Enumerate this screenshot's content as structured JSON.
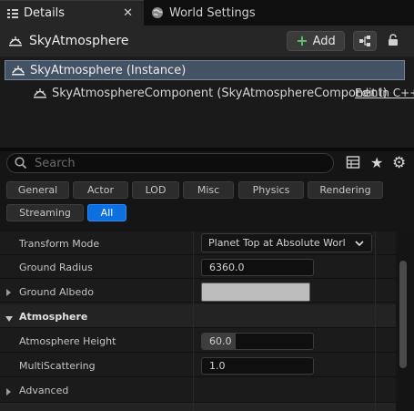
{
  "tabs": [
    {
      "label": "Details",
      "icon": "details-icon",
      "active": true
    },
    {
      "label": "World Settings",
      "icon": "globe-icon",
      "active": false
    }
  ],
  "header": {
    "title": "SkyAtmosphere",
    "add_label": "Add"
  },
  "tree": {
    "root_label": "SkyAtmosphere (Instance)",
    "child_label": "SkyAtmosphereComponent (SkyAtmosphereComponent)",
    "edit_link": "Edit in C++"
  },
  "search": {
    "placeholder": "Search",
    "value": ""
  },
  "filters": [
    "General",
    "Actor",
    "LOD",
    "Misc",
    "Physics",
    "Rendering",
    "Streaming",
    "All"
  ],
  "active_filter": "All",
  "properties": {
    "transform_mode": {
      "label": "Transform Mode",
      "value": "Planet Top at Absolute World Origin"
    },
    "ground_radius": {
      "label": "Ground Radius",
      "value": "6360.0"
    },
    "ground_albedo": {
      "label": "Ground Albedo",
      "color": "#bdbdbd"
    },
    "atmosphere_section": "Atmosphere",
    "atmosphere_height": {
      "label": "Atmosphere Height",
      "value": "60.0",
      "fill": 0.3
    },
    "multiscattering": {
      "label": "MultiScattering",
      "value": "1.0"
    },
    "advanced_section": "Advanced"
  },
  "colors": {
    "selection": "#445265",
    "accent": "#0e70e0",
    "add_plus": "#4caf50"
  }
}
